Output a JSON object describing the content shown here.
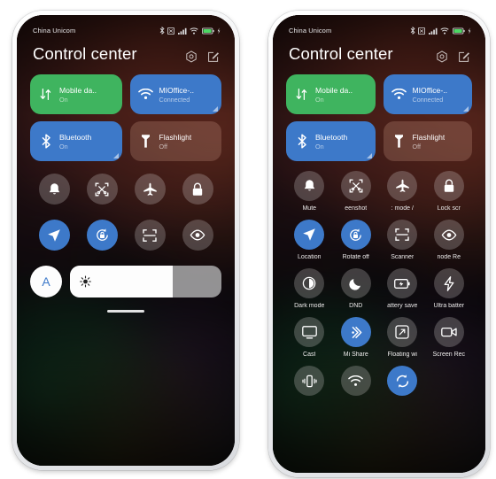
{
  "statusbar": {
    "carrier": "China Unicom",
    "icons": [
      "bluetooth-icon",
      "sim-icon",
      "signal-icon",
      "wifi-icon",
      "battery-icon",
      "charging-icon"
    ]
  },
  "header": {
    "title": "Control center",
    "settings_icon": "hex-settings-icon",
    "edit_icon": "edit-icon"
  },
  "colors": {
    "accent_blue": "#3d79c9",
    "green": "#3fb45f",
    "tile_dim": "rgba(210,160,140,.26)"
  },
  "tiles": [
    {
      "name": "mobile-data",
      "label": "Mobile da..",
      "status": "On",
      "state": "green",
      "icon": "mobile-data-icon",
      "expand": false
    },
    {
      "name": "wifi",
      "label": "MIOffice-..",
      "status": "Connected",
      "state": "blue",
      "icon": "wifi-icon",
      "expand": true
    },
    {
      "name": "bluetooth",
      "label": "Bluetooth",
      "status": "On",
      "state": "blue",
      "icon": "bluetooth-icon",
      "expand": true
    },
    {
      "name": "flashlight",
      "label": "Flashlight",
      "status": "Off",
      "state": "dim",
      "icon": "flashlight-icon",
      "expand": false
    }
  ],
  "left_toggles": [
    {
      "name": "mute",
      "icon": "bell-icon",
      "active": false
    },
    {
      "name": "screenshot",
      "icon": "screenshot-icon",
      "active": false
    },
    {
      "name": "airplane-mode",
      "icon": "airplane-icon",
      "active": false
    },
    {
      "name": "lock-screen",
      "icon": "lock-icon",
      "active": false
    },
    {
      "name": "location",
      "icon": "location-icon",
      "active": true
    },
    {
      "name": "rotate-off",
      "icon": "rotate-lock-icon",
      "active": true
    },
    {
      "name": "scanner",
      "icon": "scanner-icon",
      "active": false
    },
    {
      "name": "reading-mode",
      "icon": "eye-icon",
      "active": false
    }
  ],
  "right_toggles": [
    {
      "name": "mute",
      "icon": "bell-icon",
      "label": "Mute",
      "active": false
    },
    {
      "name": "screenshot",
      "icon": "screenshot-icon",
      "label": "eenshot",
      "active": false
    },
    {
      "name": "airplane-mode",
      "icon": "airplane-icon",
      "label": ": mode   /",
      "active": false
    },
    {
      "name": "lock-screen",
      "icon": "lock-icon",
      "label": "Lock scr",
      "active": false
    },
    {
      "name": "location",
      "icon": "location-icon",
      "label": "Location",
      "active": true
    },
    {
      "name": "rotate-off",
      "icon": "rotate-lock-icon",
      "label": "Rotate off",
      "active": true
    },
    {
      "name": "scanner",
      "icon": "scanner-icon",
      "label": "Scanner",
      "active": false
    },
    {
      "name": "reading-mode",
      "icon": "eye-icon",
      "label": "node     Re",
      "active": false
    },
    {
      "name": "dark-mode",
      "icon": "contrast-icon",
      "label": "Dark mode",
      "active": false
    },
    {
      "name": "dnd",
      "icon": "moon-icon",
      "label": "DND",
      "active": false
    },
    {
      "name": "battery-saver",
      "icon": "battery-save-icon",
      "label": "attery save",
      "active": false
    },
    {
      "name": "ultra-battery-saver",
      "icon": "bolt-icon",
      "label": "Ultra batter",
      "active": false
    },
    {
      "name": "cast",
      "icon": "cast-icon",
      "label": "Cast",
      "active": false
    },
    {
      "name": "mi-share",
      "icon": "mi-share-icon",
      "label": "Mi Share",
      "active": true
    },
    {
      "name": "floating-windows",
      "icon": "floating-window-icon",
      "label": "Floating wi",
      "active": false
    },
    {
      "name": "screen-recorder",
      "icon": "video-camera-icon",
      "label": "Screen Rec",
      "active": false
    },
    {
      "name": "vibrate",
      "icon": "vibrate-icon",
      "label": "",
      "active": false
    },
    {
      "name": "hotspot",
      "icon": "hotspot-icon",
      "label": "",
      "active": false
    },
    {
      "name": "sync",
      "icon": "sync-icon",
      "label": "",
      "active": true
    }
  ],
  "brightness": {
    "auto_label": "A",
    "icon": "brightness-icon",
    "level_percent": 68
  }
}
